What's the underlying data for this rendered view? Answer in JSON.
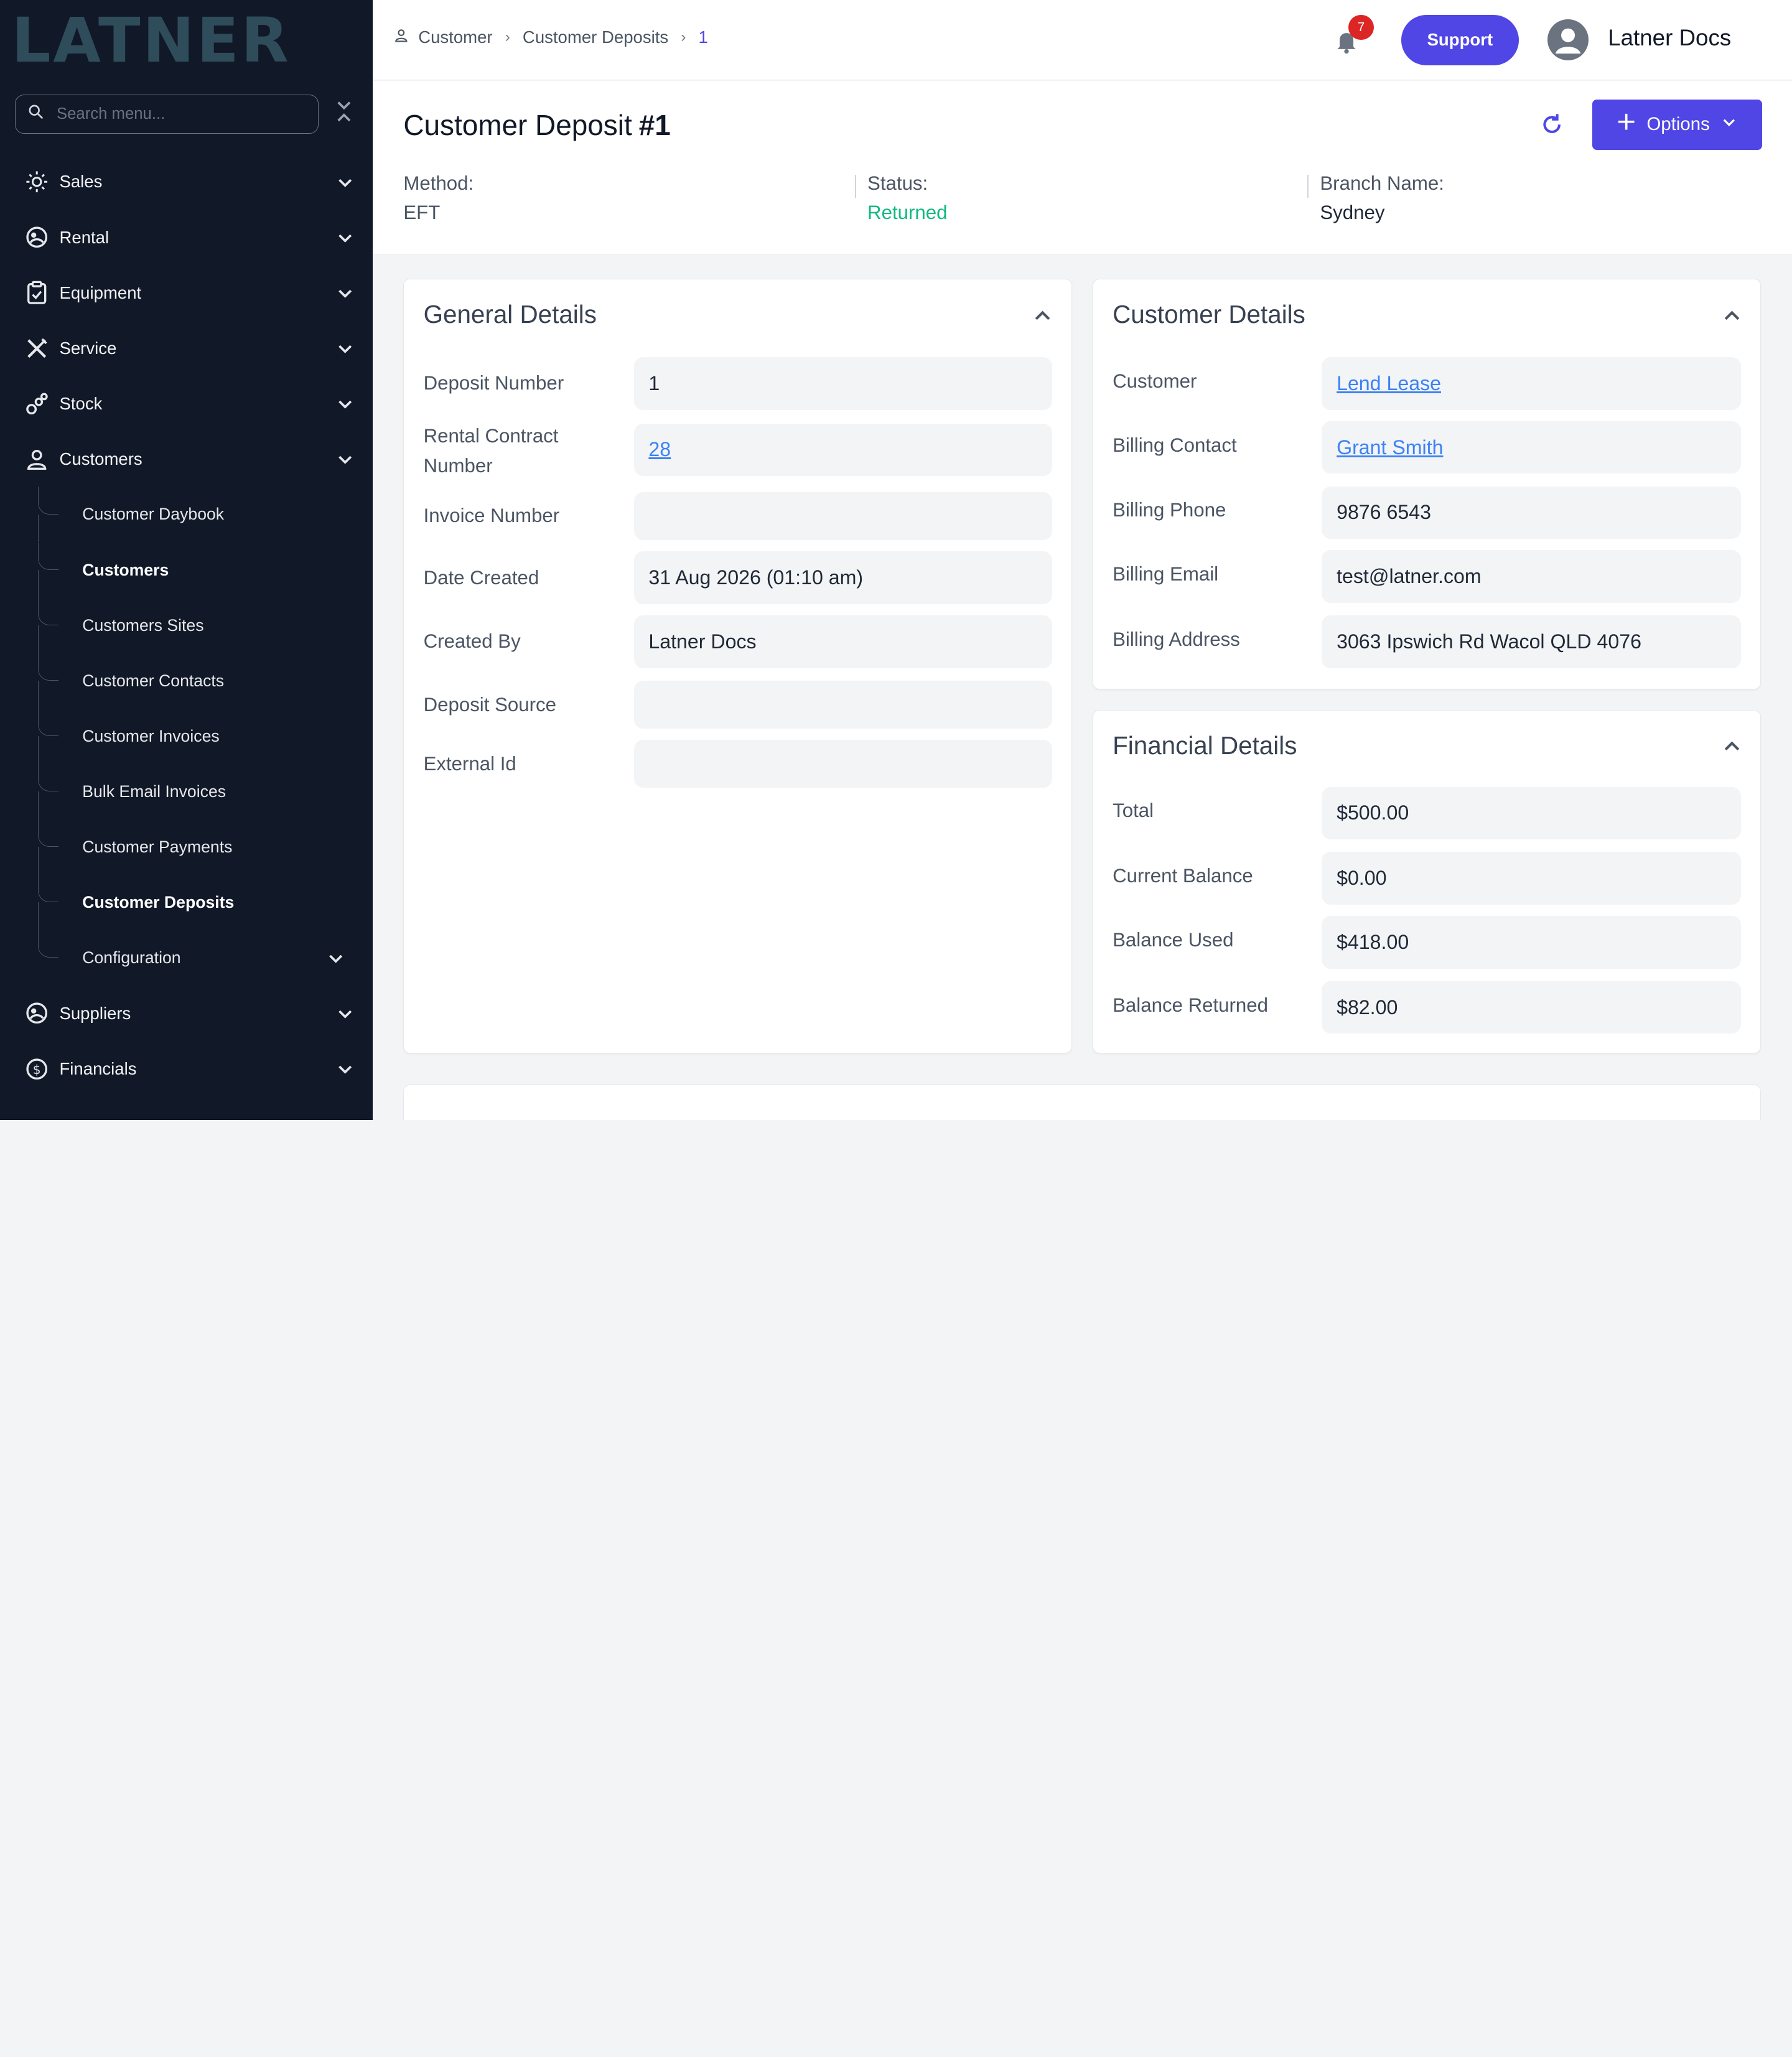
{
  "app": {
    "logo_text": "LATNER"
  },
  "sidebar": {
    "search_placeholder": "Search menu...",
    "items": [
      {
        "label": "Sales",
        "icon": "sales-icon"
      },
      {
        "label": "Rental",
        "icon": "rental-icon"
      },
      {
        "label": "Equipment",
        "icon": "equipment-icon"
      },
      {
        "label": "Service",
        "icon": "service-icon"
      },
      {
        "label": "Stock",
        "icon": "stock-icon"
      },
      {
        "label": "Customers",
        "icon": "customers-icon"
      }
    ],
    "sub_items": [
      {
        "label": "Customer Daybook"
      },
      {
        "label": "Customers"
      },
      {
        "label": "Customers Sites"
      },
      {
        "label": "Customer Contacts"
      },
      {
        "label": "Customer Invoices"
      },
      {
        "label": "Bulk Email Invoices"
      },
      {
        "label": "Customer Payments"
      },
      {
        "label": "Customer Deposits"
      },
      {
        "label": "Configuration"
      }
    ],
    "bottom_items": [
      {
        "label": "Suppliers",
        "icon": "suppliers-icon"
      },
      {
        "label": "Financials",
        "icon": "financials-icon"
      }
    ]
  },
  "topbar": {
    "breadcrumb": [
      "Customer",
      "Customer Deposits",
      "1"
    ],
    "notification_count": "7",
    "support_label": "Support",
    "user_name": "Latner Docs"
  },
  "header": {
    "title": "Customer Deposit",
    "number": "#1",
    "options_label": "Options",
    "meta": [
      {
        "label": "Method:",
        "value": "EFT"
      },
      {
        "label": "Status:",
        "value": "Returned"
      },
      {
        "label": "Branch Name:",
        "value": "Sydney"
      }
    ]
  },
  "general_details": {
    "title": "General Details",
    "rows": [
      {
        "label": "Deposit Number",
        "value": "1"
      },
      {
        "label": "Rental Contract Number",
        "value": "28"
      },
      {
        "label": "Invoice Number",
        "value": ""
      },
      {
        "label": "Date Created",
        "value": "31 Aug 2026 (01:10 am)"
      },
      {
        "label": "Created By",
        "value": "Latner Docs"
      },
      {
        "label": "Deposit Source",
        "value": ""
      },
      {
        "label": "External Id",
        "value": ""
      }
    ]
  },
  "customer_details": {
    "title": "Customer Details",
    "rows": [
      {
        "label": "Customer",
        "value": "Lend Lease"
      },
      {
        "label": "Billing Contact",
        "value": "Grant Smith"
      },
      {
        "label": "Billing Phone",
        "value": "9876 6543"
      },
      {
        "label": "Billing Email",
        "value": "test@latner.com"
      },
      {
        "label": "Billing Address",
        "value": "3063 Ipswich Rd Wacol QLD 4076"
      }
    ]
  },
  "financial_details": {
    "title": "Financial Details",
    "rows": [
      {
        "label": "Total",
        "value": "$500.00"
      },
      {
        "label": "Current Balance",
        "value": "$0.00"
      },
      {
        "label": "Balance Used",
        "value": "$418.00"
      },
      {
        "label": "Balance Returned",
        "value": "$82.00"
      }
    ]
  },
  "colors": {
    "sidebar_bg": "#111827",
    "accent": "#4f46e5",
    "status_returned": "#10b981",
    "link": "#3b82f6"
  }
}
